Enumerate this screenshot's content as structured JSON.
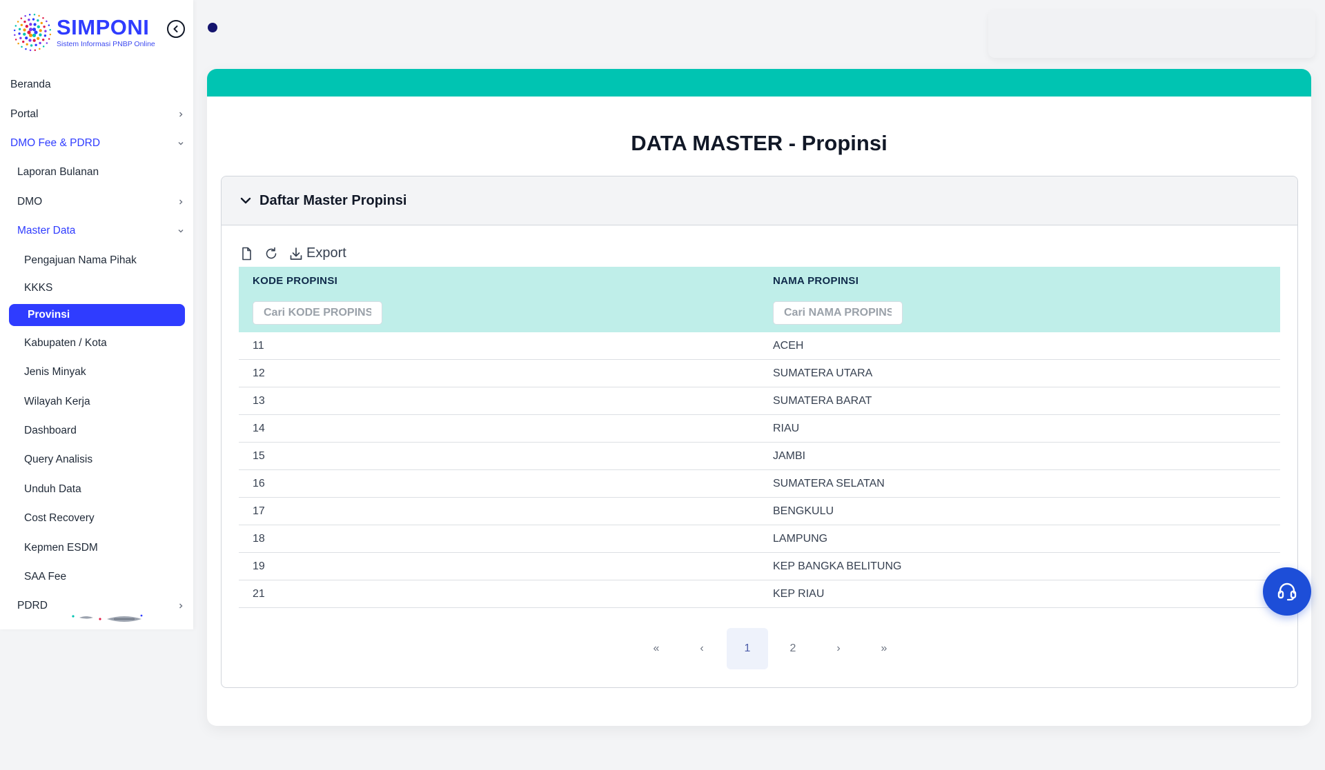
{
  "brand": {
    "name": "SIMPONI",
    "subtitle": "Sistem Informasi PNBP Online"
  },
  "colors": {
    "brand_blue": "#2f3cff",
    "teal_band": "#00c4b2",
    "table_header": "#bfeee9",
    "help_button": "#1d4ed8"
  },
  "sidebar": {
    "items": [
      {
        "label": "Beranda"
      },
      {
        "label": "Portal"
      },
      {
        "label": "DMO Fee & PDRD"
      },
      {
        "label": "Laporan Bulanan"
      },
      {
        "label": "DMO"
      },
      {
        "label": "Master Data"
      },
      {
        "label": "Pengajuan Nama Pihak"
      },
      {
        "label": "KKKS"
      },
      {
        "label": "Provinsi"
      },
      {
        "label": "Kabupaten / Kota"
      },
      {
        "label": "Jenis Minyak"
      },
      {
        "label": "Wilayah Kerja"
      },
      {
        "label": "Dashboard"
      },
      {
        "label": "Query Analisis"
      },
      {
        "label": "Unduh Data"
      },
      {
        "label": "Cost Recovery"
      },
      {
        "label": "Kepmen ESDM"
      },
      {
        "label": "SAA Fee"
      },
      {
        "label": "PDRD"
      }
    ]
  },
  "main": {
    "page_title": "DATA MASTER - Propinsi",
    "panel_title": "Daftar Master Propinsi",
    "toolbar": {
      "export_label": "Export"
    },
    "table": {
      "columns": [
        "KODE PROPINSI",
        "NAMA PROPINSI"
      ],
      "filters": [
        "Cari KODE PROPINSI",
        "Cari NAMA PROPINSI"
      ],
      "rows": [
        [
          "11",
          "ACEH"
        ],
        [
          "12",
          "SUMATERA UTARA"
        ],
        [
          "13",
          "SUMATERA BARAT"
        ],
        [
          "14",
          "RIAU"
        ],
        [
          "15",
          "JAMBI"
        ],
        [
          "16",
          "SUMATERA SELATAN"
        ],
        [
          "17",
          "BENGKULU"
        ],
        [
          "18",
          "LAMPUNG"
        ],
        [
          "19",
          "KEP BANGKA BELITUNG"
        ],
        [
          "21",
          "KEP RIAU"
        ]
      ]
    },
    "pagination": {
      "first": "«",
      "prev": "‹",
      "pages": [
        "1",
        "2"
      ],
      "current": "1",
      "next": "›",
      "last": "»"
    }
  }
}
